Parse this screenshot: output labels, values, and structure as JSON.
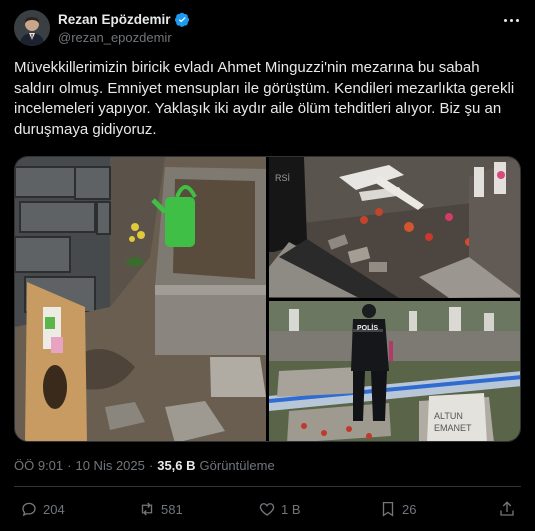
{
  "author": {
    "display_name": "Rezan Epözdemir",
    "handle": "@rezan_epozdemir",
    "verified_icon": "verified-badge-icon",
    "accent_color": "#1d9bf0"
  },
  "tweet": {
    "text": "Müvekkillerimizin biricik evladı Ahmet Minguzzi'nin mezarına bu sabah saldırı olmuş. Emniyet mensupları ile görüştüm. Kendileri mezarlıkta gerekli incelemeleri yapıyor. Yaklaşık iki aydır aile ölüm tehditleri alıyor. Biz şu an duruşmaya gidiyoruz."
  },
  "media": {
    "photos": [
      {
        "icon": "grave-with-watering-can-photo"
      },
      {
        "icon": "vandalized-grave-photo"
      },
      {
        "icon": "police-officer-at-cemetery-photo",
        "police_text": "POLİS",
        "stone_text_1": "ALTUN",
        "stone_text_2": "EMANET"
      }
    ],
    "photo1_texts": {
      "stone_label": ""
    },
    "photo2_texts": {
      "stone_label": "RSİ"
    }
  },
  "meta": {
    "time": "ÖÖ 9:01",
    "separator": "·",
    "date": "10 Nis 2025",
    "separator2": "·",
    "views_count": "35,6 B",
    "views_label": "Görüntüleme"
  },
  "actions": {
    "replies": "204",
    "reposts": "581",
    "likes": "1 B",
    "bookmarks": "26"
  }
}
